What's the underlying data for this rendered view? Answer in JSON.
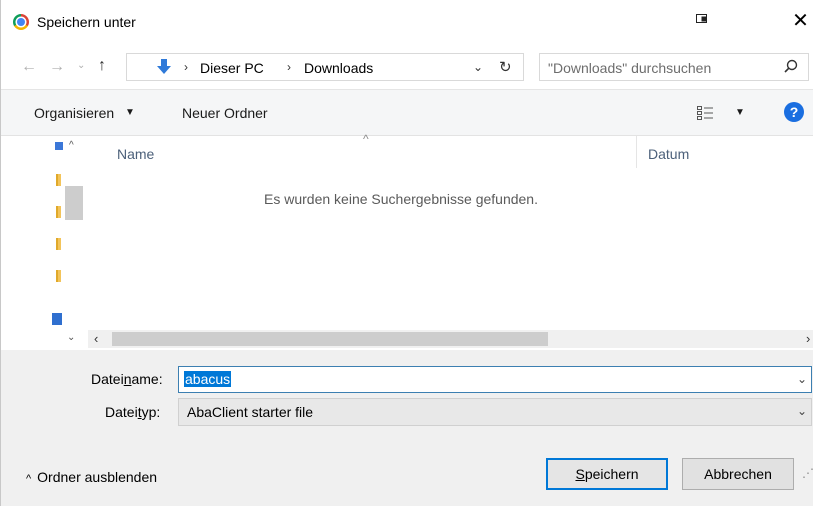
{
  "window": {
    "title": "Speichern unter",
    "icon": "chrome-icon"
  },
  "address": {
    "segments": [
      "Dieser PC",
      "Downloads"
    ],
    "separator": "›"
  },
  "search": {
    "placeholder": "\"Downloads\" durchsuchen"
  },
  "toolbar": {
    "organize_label": "Organisieren",
    "new_folder_label": "Neuer Ordner",
    "help_label": "?"
  },
  "columns": {
    "name": "Name",
    "date": "Datum"
  },
  "content": {
    "empty_message": "Es wurden keine Suchergebnisse gefunden."
  },
  "form": {
    "filename_label_pre": "Datei",
    "filename_label_u": "n",
    "filename_label_post": "ame:",
    "filename_value": "abacus",
    "filetype_label_pre": "Datei",
    "filetype_label_u": "t",
    "filetype_label_post": "yp:",
    "filetype_value": "AbaClient starter file"
  },
  "footer": {
    "hide_folders_label": "Ordner ausblenden",
    "save_u": "S",
    "save_rest": "peichern",
    "cancel_label": "Abbrechen"
  },
  "colors": {
    "accent": "#0078d7",
    "help": "#1a6ee0",
    "folder": "#f3c45a"
  }
}
